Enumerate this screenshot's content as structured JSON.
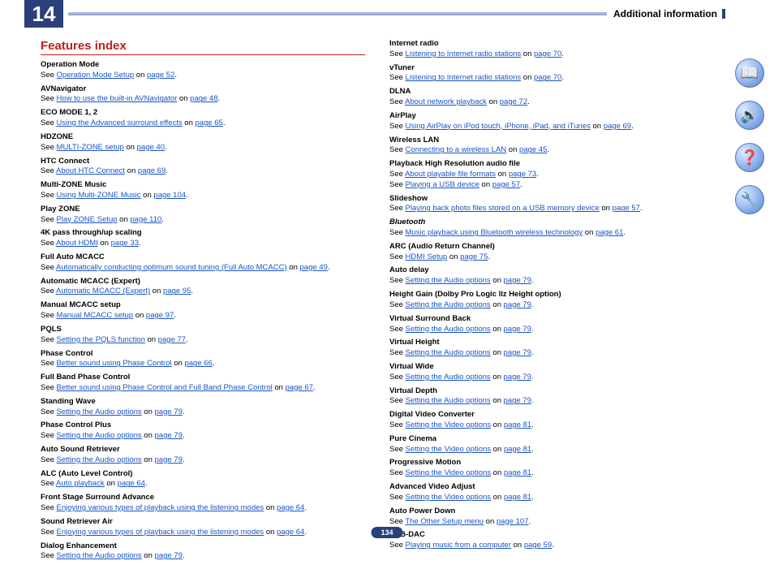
{
  "header": {
    "chapter": "14",
    "title": "Additional information"
  },
  "index_title": "Features index",
  "page_number": "134",
  "icons": [
    "📖",
    "🔊",
    "❓",
    "🔧"
  ],
  "left": [
    {
      "title": "Operation Mode",
      "link": "Operation Mode Setup",
      "page": "page 52"
    },
    {
      "title": "AVNavigator",
      "link": "How to use the built-in AVNavigator",
      "page": "page 48"
    },
    {
      "title": "ECO MODE 1, 2",
      "link": "Using the Advanced surround effects",
      "page": "page 65"
    },
    {
      "title": "HDZONE",
      "link": "MULTI-ZONE setup",
      "page": "page 40"
    },
    {
      "title": "HTC Connect",
      "link": "About HTC Connect",
      "page": "page 69"
    },
    {
      "title": "Multi-ZONE Music",
      "link": "Using Multi-ZONE Music",
      "page": "page 104"
    },
    {
      "title": "Play ZONE",
      "link": "Play ZONE Setup",
      "page": "page 110"
    },
    {
      "title": "4K pass through/up scaling",
      "link": "About HDMI",
      "page": "page 33"
    },
    {
      "title": "Full Auto MCACC",
      "link": "Automatically conducting optimum sound tuning (Full Auto MCACC)",
      "page": "page 49"
    },
    {
      "title": "Automatic MCACC (Expert)",
      "link": "Automatic MCACC (Expert)",
      "page": "page 95"
    },
    {
      "title": "Manual MCACC setup",
      "link": "Manual MCACC setup",
      "page": "page 97"
    },
    {
      "title": "PQLS",
      "link": "Setting the PQLS function",
      "page": "page 77"
    },
    {
      "title": "Phase Control",
      "link": "Better sound using Phase Control",
      "page": "page 66"
    },
    {
      "title": "Full Band Phase Control",
      "link": "Better sound using Phase Control and Full Band Phase Control",
      "page": "page 67"
    },
    {
      "title": "Standing Wave",
      "link": "Setting the Audio options",
      "page": "page 79"
    },
    {
      "title": "Phase Control Plus",
      "link": "Setting the Audio options",
      "page": "page 79"
    },
    {
      "title": "Auto Sound Retriever",
      "link": "Setting the Audio options",
      "page": "page 79"
    },
    {
      "title": "ALC (Auto Level Control)",
      "link": "Auto playback",
      "page": "page 64"
    },
    {
      "title": "Front Stage Surround Advance",
      "link": "Enjoying various types of playback using the listening modes",
      "page": "page 64"
    },
    {
      "title": "Sound Retriever Air",
      "link": "Enjoying various types of playback using the listening modes",
      "page": "page 64"
    },
    {
      "title": "Dialog Enhancement",
      "link": "Setting the Audio options",
      "page": "page 79"
    }
  ],
  "right": [
    {
      "title": "Internet radio",
      "link": "Listening to Internet radio stations",
      "page": "page 70"
    },
    {
      "title": "vTuner",
      "link": "Listening to Internet radio stations",
      "page": "page 70"
    },
    {
      "title": "DLNA",
      "link": "About network playback",
      "page": "page 72"
    },
    {
      "title": "AirPlay",
      "link": "Using AirPlay on iPod touch, iPhone, iPad, and iTunes",
      "page": "page 69"
    },
    {
      "title": "Wireless LAN",
      "link": "Connecting to a wireless LAN",
      "page": "page 45"
    },
    {
      "title": "Playback High Resolution audio file",
      "link": "About playable file formats",
      "page": "page 73",
      "extra_link": "Playing a USB device",
      "extra_page": "page 57"
    },
    {
      "title": "Slideshow",
      "link": "Playing back photo files stored on a USB memory device",
      "page": "page 57"
    },
    {
      "title": "Bluetooth",
      "italic": true,
      "link": "Music playback using Bluetooth wireless technology",
      "page": "page 61"
    },
    {
      "title": "ARC (Audio Return Channel)",
      "link": "HDMI Setup",
      "page": "page 75"
    },
    {
      "title": "Auto delay",
      "link": "Setting the Audio options",
      "page": "page 79"
    },
    {
      "title": "Height Gain (Dolby Pro Logic llz Height option)",
      "link": "Setting the Audio options",
      "page": "page 79"
    },
    {
      "title": "Virtual Surround Back",
      "link": "Setting the Audio options",
      "page": "page 79"
    },
    {
      "title": "Virtual Height",
      "link": "Setting the Audio options",
      "page": "page 79"
    },
    {
      "title": "Virtual Wide",
      "link": "Setting the Audio options",
      "page": "page 79"
    },
    {
      "title": "Virtual Depth",
      "link": "Setting the Audio options",
      "page": "page 79"
    },
    {
      "title": "Digital Video Converter",
      "link": "Setting the Video options",
      "page": "page 81"
    },
    {
      "title": "Pure Cinema",
      "link": "Setting the Video options",
      "page": "page 81"
    },
    {
      "title": "Progressive Motion",
      "link": "Setting the Video options",
      "page": "page 81"
    },
    {
      "title": "Advanced Video Adjust",
      "link": "Setting the Video options",
      "page": "page 81"
    },
    {
      "title": "Auto Power Down",
      "link": "The Other Setup menu",
      "page": "page 107"
    },
    {
      "title": "USB-DAC",
      "link": "Playing music from a computer",
      "page": "page 59"
    }
  ],
  "see_text": "See ",
  "on_text": " on ",
  "period": "."
}
